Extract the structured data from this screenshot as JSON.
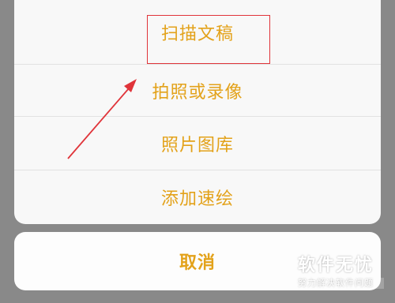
{
  "action_sheet": {
    "options": [
      {
        "label": "扫描文稿"
      },
      {
        "label": "拍照或录像"
      },
      {
        "label": "照片图库"
      },
      {
        "label": "添加速绘"
      }
    ],
    "cancel_label": "取消"
  },
  "watermark": {
    "title": "软件无忧",
    "subtitle": "努力解决软件问题"
  },
  "colors": {
    "accent_text": "#e3a21a",
    "highlight_border": "#e0343a",
    "overlay": "#898989",
    "sheet_background": "#f8f8f8"
  }
}
